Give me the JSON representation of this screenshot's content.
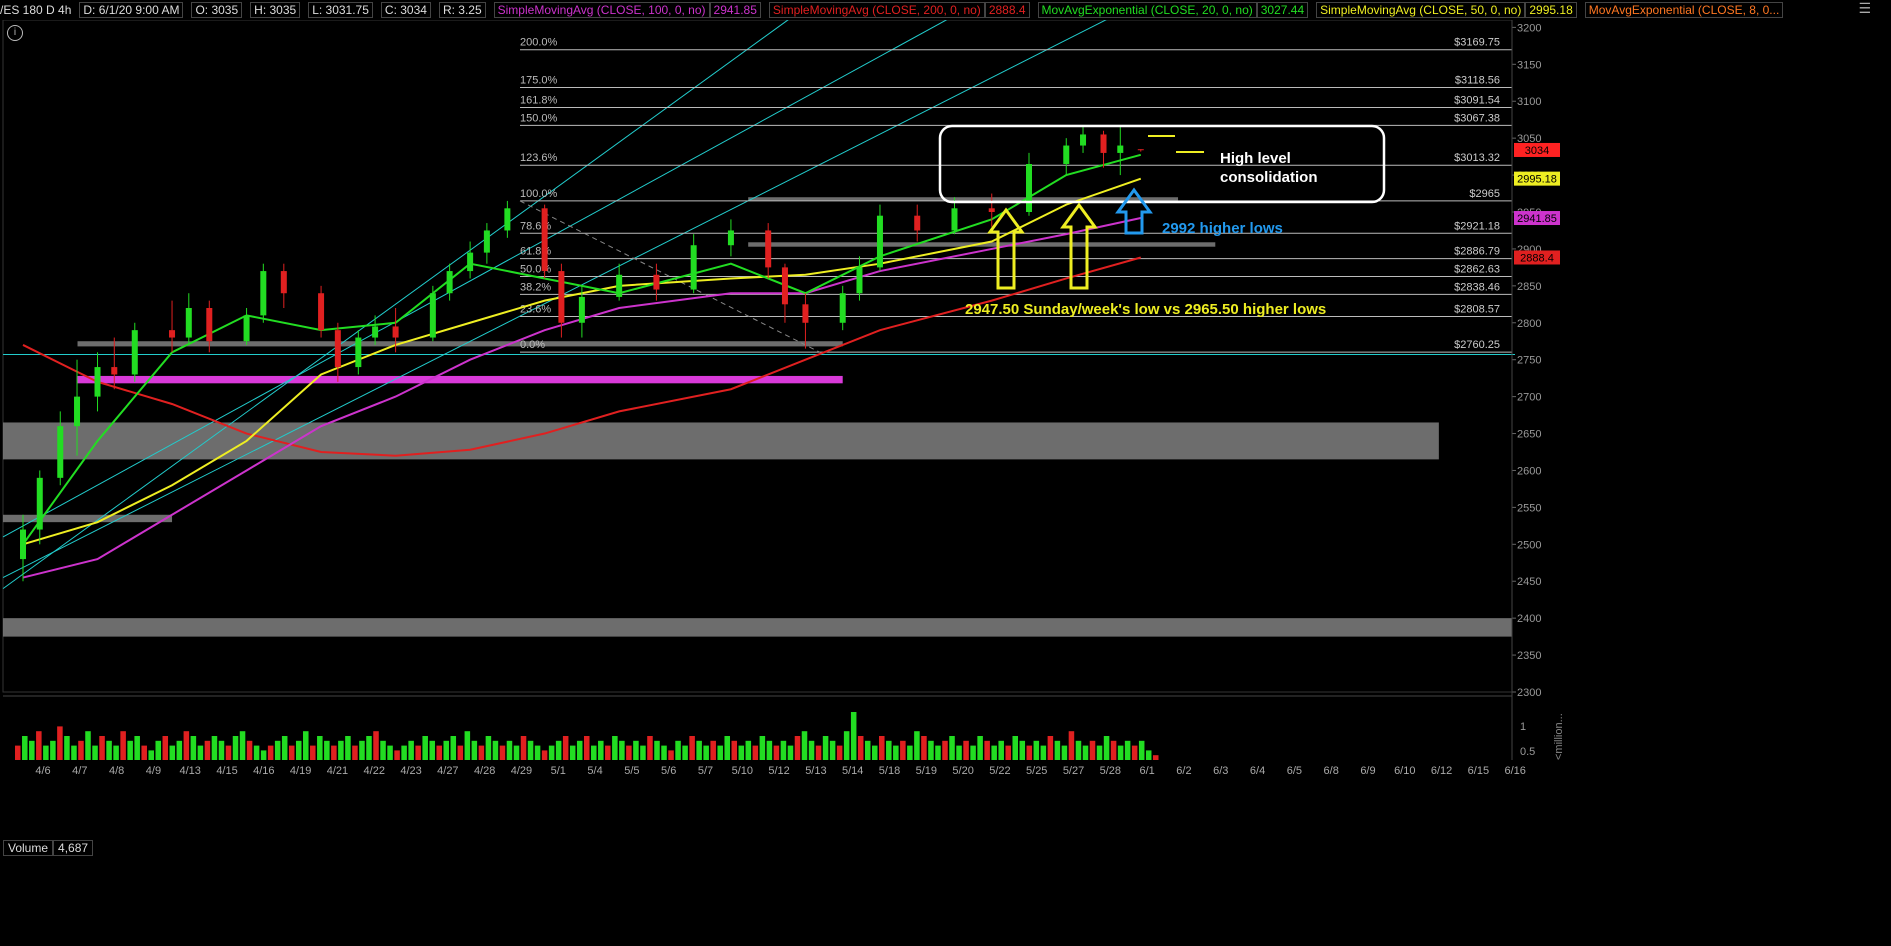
{
  "header": {
    "symbol": "/ES 180 D 4h",
    "date": "D: 6/1/20 9:00 AM",
    "open": "O: 3035",
    "high": "H: 3035",
    "low": "L: 3031.75",
    "close": "C: 3034",
    "range": "R: 3.25",
    "studies": [
      {
        "label": "SimpleMovingAvg (CLOSE, 100, 0, no)",
        "value": "2941.85",
        "color": "#cc33cc"
      },
      {
        "label": "SimpleMovingAvg (CLOSE, 200, 0, no)",
        "value": "2888.4",
        "color": "#e02020"
      },
      {
        "label": "MovAvgExponential (CLOSE, 20, 0, no)",
        "value": "3027.44",
        "color": "#22dd22"
      },
      {
        "label": "SimpleMovingAvg (CLOSE, 50, 0, no)",
        "value": "2995.18",
        "color": "#eeee22"
      },
      {
        "label": "MovAvgExponential (CLOSE, 8, 0...",
        "value": "",
        "color": "#ff7722"
      }
    ]
  },
  "icons": {
    "menu": "menu-icon",
    "info": "info-icon"
  },
  "volume": {
    "label": "Volume",
    "value": "4,687",
    "unit_label": "<million...",
    "ticks": [
      "1",
      "0.5"
    ]
  },
  "chart_data": {
    "type": "candlestick",
    "y_ticks": [
      2300,
      2350,
      2400,
      2450,
      2500,
      2550,
      2600,
      2650,
      2700,
      2750,
      2800,
      2850,
      2900,
      2950,
      3000,
      3050,
      3100,
      3150,
      3200
    ],
    "ylim": [
      2300,
      3210
    ],
    "x_labels": [
      "4/6",
      "4/7",
      "4/8",
      "4/9",
      "4/13",
      "4/15",
      "4/16",
      "4/19",
      "4/21",
      "4/22",
      "4/23",
      "4/27",
      "4/28",
      "4/29",
      "5/1",
      "5/4",
      "5/5",
      "5/6",
      "5/7",
      "5/10",
      "5/12",
      "5/13",
      "5/14",
      "5/18",
      "5/19",
      "5/20",
      "5/22",
      "5/25",
      "5/27",
      "5/28",
      "6/1",
      "6/2",
      "6/3",
      "6/4",
      "6/5",
      "6/8",
      "6/9",
      "6/10",
      "6/12",
      "6/15",
      "6/16"
    ],
    "close_path": [
      [
        "4/6",
        2480
      ],
      [
        "4/6",
        2510
      ],
      [
        "4/7",
        2600
      ],
      [
        "4/7",
        2680
      ],
      [
        "4/8",
        2720
      ],
      [
        "4/8",
        2750
      ],
      [
        "4/9",
        2770
      ],
      [
        "4/13",
        2790
      ],
      [
        "4/13",
        2810
      ],
      [
        "4/15",
        2770
      ],
      [
        "4/16",
        2800
      ],
      [
        "4/16",
        2870
      ],
      [
        "4/19",
        2840
      ],
      [
        "4/21",
        2790
      ],
      [
        "4/21",
        2740
      ],
      [
        "4/22",
        2770
      ],
      [
        "4/22",
        2790
      ],
      [
        "4/23",
        2780
      ],
      [
        "4/27",
        2830
      ],
      [
        "4/27",
        2870
      ],
      [
        "4/28",
        2900
      ],
      [
        "4/28",
        2920
      ],
      [
        "4/29",
        2950
      ],
      [
        "5/1",
        2870
      ],
      [
        "5/1",
        2810
      ],
      [
        "5/4",
        2830
      ],
      [
        "5/5",
        2860
      ],
      [
        "5/6",
        2850
      ],
      [
        "5/7",
        2900
      ],
      [
        "5/10",
        2920
      ],
      [
        "5/12",
        2880
      ],
      [
        "5/12",
        2830
      ],
      [
        "5/13",
        2800
      ],
      [
        "5/14",
        2820
      ],
      [
        "5/14",
        2870
      ],
      [
        "5/18",
        2940
      ],
      [
        "5/19",
        2930
      ],
      [
        "5/20",
        2950
      ],
      [
        "5/22",
        2950
      ],
      [
        "5/25",
        3000
      ],
      [
        "5/27",
        3030
      ],
      [
        "5/27",
        3050
      ],
      [
        "5/28",
        3040
      ],
      [
        "5/28",
        3034
      ]
    ],
    "candles": [
      {
        "d": "4/6",
        "o": 2480,
        "h": 2540,
        "l": 2450,
        "c": 2520
      },
      {
        "d": "4/6",
        "o": 2520,
        "h": 2600,
        "l": 2500,
        "c": 2590
      },
      {
        "d": "4/7",
        "o": 2590,
        "h": 2680,
        "l": 2580,
        "c": 2660
      },
      {
        "d": "4/7",
        "o": 2660,
        "h": 2750,
        "l": 2620,
        "c": 2700
      },
      {
        "d": "4/8",
        "o": 2700,
        "h": 2760,
        "l": 2680,
        "c": 2740
      },
      {
        "d": "4/8",
        "o": 2740,
        "h": 2780,
        "l": 2710,
        "c": 2730
      },
      {
        "d": "4/9",
        "o": 2730,
        "h": 2800,
        "l": 2720,
        "c": 2790
      },
      {
        "d": "4/13",
        "o": 2790,
        "h": 2830,
        "l": 2760,
        "c": 2780
      },
      {
        "d": "4/13",
        "o": 2780,
        "h": 2840,
        "l": 2770,
        "c": 2820
      },
      {
        "d": "4/15",
        "o": 2820,
        "h": 2830,
        "l": 2760,
        "c": 2775
      },
      {
        "d": "4/16",
        "o": 2775,
        "h": 2820,
        "l": 2770,
        "c": 2810
      },
      {
        "d": "4/16",
        "o": 2810,
        "h": 2880,
        "l": 2800,
        "c": 2870
      },
      {
        "d": "4/19",
        "o": 2870,
        "h": 2880,
        "l": 2820,
        "c": 2840
      },
      {
        "d": "4/21",
        "o": 2840,
        "h": 2850,
        "l": 2780,
        "c": 2790
      },
      {
        "d": "4/21",
        "o": 2790,
        "h": 2800,
        "l": 2720,
        "c": 2740
      },
      {
        "d": "4/22",
        "o": 2740,
        "h": 2790,
        "l": 2730,
        "c": 2780
      },
      {
        "d": "4/22",
        "o": 2780,
        "h": 2810,
        "l": 2770,
        "c": 2795
      },
      {
        "d": "4/23",
        "o": 2795,
        "h": 2820,
        "l": 2760,
        "c": 2780
      },
      {
        "d": "4/27",
        "o": 2780,
        "h": 2850,
        "l": 2775,
        "c": 2840
      },
      {
        "d": "4/27",
        "o": 2840,
        "h": 2880,
        "l": 2830,
        "c": 2870
      },
      {
        "d": "4/28",
        "o": 2870,
        "h": 2910,
        "l": 2860,
        "c": 2895
      },
      {
        "d": "4/28",
        "o": 2895,
        "h": 2935,
        "l": 2880,
        "c": 2925
      },
      {
        "d": "4/29",
        "o": 2925,
        "h": 2965,
        "l": 2915,
        "c": 2955
      },
      {
        "d": "5/1",
        "o": 2955,
        "h": 2960,
        "l": 2860,
        "c": 2870
      },
      {
        "d": "5/1",
        "o": 2870,
        "h": 2880,
        "l": 2780,
        "c": 2800
      },
      {
        "d": "5/4",
        "o": 2800,
        "h": 2850,
        "l": 2780,
        "c": 2835
      },
      {
        "d": "5/5",
        "o": 2835,
        "h": 2880,
        "l": 2830,
        "c": 2865
      },
      {
        "d": "5/6",
        "o": 2865,
        "h": 2880,
        "l": 2830,
        "c": 2845
      },
      {
        "d": "5/7",
        "o": 2845,
        "h": 2920,
        "l": 2840,
        "c": 2905
      },
      {
        "d": "5/10",
        "o": 2905,
        "h": 2940,
        "l": 2890,
        "c": 2925
      },
      {
        "d": "5/12",
        "o": 2925,
        "h": 2935,
        "l": 2860,
        "c": 2875
      },
      {
        "d": "5/12",
        "o": 2875,
        "h": 2880,
        "l": 2800,
        "c": 2825
      },
      {
        "d": "5/13",
        "o": 2825,
        "h": 2840,
        "l": 2765,
        "c": 2800
      },
      {
        "d": "5/14",
        "o": 2800,
        "h": 2850,
        "l": 2790,
        "c": 2840
      },
      {
        "d": "5/14",
        "o": 2840,
        "h": 2890,
        "l": 2830,
        "c": 2875
      },
      {
        "d": "5/18",
        "o": 2875,
        "h": 2960,
        "l": 2870,
        "c": 2945
      },
      {
        "d": "5/19",
        "o": 2945,
        "h": 2960,
        "l": 2910,
        "c": 2925
      },
      {
        "d": "5/20",
        "o": 2925,
        "h": 2970,
        "l": 2920,
        "c": 2955
      },
      {
        "d": "5/22",
        "o": 2955,
        "h": 2975,
        "l": 2930,
        "c": 2950
      },
      {
        "d": "5/25",
        "o": 2950,
        "h": 3030,
        "l": 2945,
        "c": 3015
      },
      {
        "d": "5/27",
        "o": 3015,
        "h": 3050,
        "l": 3000,
        "c": 3040
      },
      {
        "d": "5/27",
        "o": 3040,
        "h": 3065,
        "l": 3030,
        "c": 3055
      },
      {
        "d": "5/28",
        "o": 3055,
        "h": 3060,
        "l": 3010,
        "c": 3030
      },
      {
        "d": "5/28",
        "o": 3030,
        "h": 3065,
        "l": 3000,
        "c": 3040
      },
      {
        "d": "6/1",
        "o": 3035,
        "h": 3035,
        "l": 3031.75,
        "c": 3034
      }
    ],
    "moving_averages": [
      {
        "name": "SMA 200",
        "color": "#e02020",
        "points": [
          [
            "4/6",
            2770
          ],
          [
            "4/8",
            2720
          ],
          [
            "4/13",
            2690
          ],
          [
            "4/16",
            2650
          ],
          [
            "4/21",
            2625
          ],
          [
            "4/23",
            2620
          ],
          [
            "4/28",
            2628
          ],
          [
            "5/1",
            2650
          ],
          [
            "5/5",
            2680
          ],
          [
            "5/10",
            2710
          ],
          [
            "5/13",
            2750
          ],
          [
            "5/18",
            2790
          ],
          [
            "5/22",
            2830
          ],
          [
            "5/27",
            2860
          ],
          [
            "6/1",
            2888.4
          ]
        ]
      },
      {
        "name": "SMA 100",
        "color": "#cc33cc",
        "points": [
          [
            "4/6",
            2455
          ],
          [
            "4/8",
            2480
          ],
          [
            "4/13",
            2540
          ],
          [
            "4/16",
            2600
          ],
          [
            "4/21",
            2660
          ],
          [
            "4/23",
            2700
          ],
          [
            "4/28",
            2750
          ],
          [
            "5/1",
            2790
          ],
          [
            "5/5",
            2820
          ],
          [
            "5/10",
            2840
          ],
          [
            "5/13",
            2840
          ],
          [
            "5/18",
            2870
          ],
          [
            "5/22",
            2900
          ],
          [
            "5/27",
            2920
          ],
          [
            "6/1",
            2941.85
          ]
        ]
      },
      {
        "name": "SMA 50",
        "color": "#eeee22",
        "points": [
          [
            "4/6",
            2500
          ],
          [
            "4/8",
            2530
          ],
          [
            "4/13",
            2580
          ],
          [
            "4/16",
            2640
          ],
          [
            "4/21",
            2730
          ],
          [
            "4/23",
            2770
          ],
          [
            "4/28",
            2800
          ],
          [
            "5/1",
            2830
          ],
          [
            "5/5",
            2850
          ],
          [
            "5/10",
            2860
          ],
          [
            "5/13",
            2865
          ],
          [
            "5/18",
            2880
          ],
          [
            "5/22",
            2910
          ],
          [
            "5/27",
            2960
          ],
          [
            "6/1",
            2995.18
          ]
        ]
      },
      {
        "name": "EMA 20",
        "color": "#22dd22",
        "points": [
          [
            "4/6",
            2500
          ],
          [
            "4/8",
            2640
          ],
          [
            "4/13",
            2760
          ],
          [
            "4/16",
            2810
          ],
          [
            "4/21",
            2790
          ],
          [
            "4/23",
            2800
          ],
          [
            "4/28",
            2880
          ],
          [
            "5/1",
            2860
          ],
          [
            "5/5",
            2840
          ],
          [
            "5/10",
            2880
          ],
          [
            "5/13",
            2840
          ],
          [
            "5/18",
            2890
          ],
          [
            "5/22",
            2940
          ],
          [
            "5/27",
            3000
          ],
          [
            "6/1",
            3027.44
          ]
        ]
      }
    ],
    "fib_levels": [
      {
        "pct": "200.0%",
        "price": "$3169.75",
        "value": 3169.75
      },
      {
        "pct": "175.0%",
        "price": "$3118.56",
        "value": 3118.56
      },
      {
        "pct": "161.8%",
        "price": "$3091.54",
        "value": 3091.54
      },
      {
        "pct": "150.0%",
        "price": "$3067.38",
        "value": 3067.38
      },
      {
        "pct": "123.6%",
        "price": "$3013.32",
        "value": 3013.32
      },
      {
        "pct": "100.0%",
        "price": "$2965",
        "value": 2965
      },
      {
        "pct": "78.6%",
        "price": "$2921.18",
        "value": 2921.18
      },
      {
        "pct": "61.8%",
        "price": "$2886.79",
        "value": 2886.79
      },
      {
        "pct": "50.0%",
        "price": "$2862.63",
        "value": 2862.63
      },
      {
        "pct": "38.2%",
        "price": "$2838.46",
        "value": 2838.46
      },
      {
        "pct": "23.6%",
        "price": "$2808.57",
        "value": 2808.57
      },
      {
        "pct": "0.0%",
        "price": "$2760.25",
        "value": 2760.25
      }
    ],
    "zones": [
      {
        "color": "#808080",
        "from": 2615,
        "to": 2665,
        "start": "4/6",
        "end": "6/12"
      },
      {
        "color": "#808080",
        "from": 2375,
        "to": 2400,
        "start": "4/6",
        "end": "6/16"
      },
      {
        "color": "#808080",
        "from": 2530,
        "to": 2540,
        "start": "4/6",
        "end": "4/13"
      },
      {
        "color": "#ff44ff",
        "from": 2718,
        "to": 2728,
        "start": "4/8",
        "end": "5/14"
      },
      {
        "color": "#808080",
        "from": 2768,
        "to": 2775,
        "start": "4/8",
        "end": "5/14"
      },
      {
        "color": "#808080",
        "from": 2965,
        "to": 2970,
        "start": "5/12",
        "end": "6/2"
      },
      {
        "color": "#808080",
        "from": 2903,
        "to": 2909,
        "start": "5/12",
        "end": "6/3"
      }
    ],
    "price_tags": [
      {
        "value": 3034,
        "label": "3034",
        "bg": "#ff2222",
        "fg": "#000"
      },
      {
        "value": 2995.18,
        "label": "2995.18",
        "bg": "#eeee22",
        "fg": "#000"
      },
      {
        "value": 2941.85,
        "label": "2941.85",
        "bg": "#cc33cc",
        "fg": "#000"
      },
      {
        "value": 2888.4,
        "label": "2888.4",
        "bg": "#e02020",
        "fg": "#000"
      }
    ],
    "annotations": {
      "box_text": [
        "High level",
        "consolidation"
      ],
      "higher_lows": "2992 higher lows",
      "weekly_low": "2947.50 Sunday/week's low vs 2965.50 higher lows"
    },
    "volume_bars": [
      0.3,
      0.5,
      0.4,
      0.6,
      0.3,
      0.4,
      0.7,
      0.5,
      0.3,
      0.4,
      0.6,
      0.3,
      0.5,
      0.4,
      0.3,
      0.6,
      0.4,
      0.5,
      0.3,
      0.2,
      0.4,
      0.5,
      0.3,
      0.4,
      0.6,
      0.5,
      0.3,
      0.4,
      0.5,
      0.4,
      0.3,
      0.5,
      0.6,
      0.4,
      0.3,
      0.2,
      0.3,
      0.4,
      0.5,
      0.3,
      0.4,
      0.6,
      0.3,
      0.5,
      0.4,
      0.3,
      0.4,
      0.5,
      0.3,
      0.4,
      0.5,
      0.6,
      0.4,
      0.3,
      0.2,
      0.3,
      0.4,
      0.3,
      0.5,
      0.4,
      0.3,
      0.4,
      0.5,
      0.3,
      0.6,
      0.4,
      0.3,
      0.5,
      0.4,
      0.3,
      0.4,
      0.3,
      0.5,
      0.4,
      0.3,
      0.2,
      0.3,
      0.4,
      0.5,
      0.3,
      0.4,
      0.5,
      0.3,
      0.4,
      0.3,
      0.5,
      0.4,
      0.3,
      0.4,
      0.3,
      0.5,
      0.4,
      0.3,
      0.2,
      0.4,
      0.3,
      0.5,
      0.4,
      0.3,
      0.4,
      0.3,
      0.5,
      0.4,
      0.3,
      0.4,
      0.3,
      0.5,
      0.4,
      0.3,
      0.4,
      0.3,
      0.5,
      0.6,
      0.4,
      0.3,
      0.5,
      0.4,
      0.3,
      0.6,
      1.0,
      0.5,
      0.4,
      0.3,
      0.5,
      0.4,
      0.3,
      0.4,
      0.3,
      0.6,
      0.5,
      0.4,
      0.3,
      0.4,
      0.5,
      0.3,
      0.4,
      0.3,
      0.5,
      0.4,
      0.3,
      0.4,
      0.3,
      0.5,
      0.4,
      0.3,
      0.4,
      0.3,
      0.5,
      0.4,
      0.3,
      0.6,
      0.4,
      0.3,
      0.4,
      0.3,
      0.5,
      0.4,
      0.3,
      0.4,
      0.3,
      0.4,
      0.2,
      0.1
    ]
  }
}
